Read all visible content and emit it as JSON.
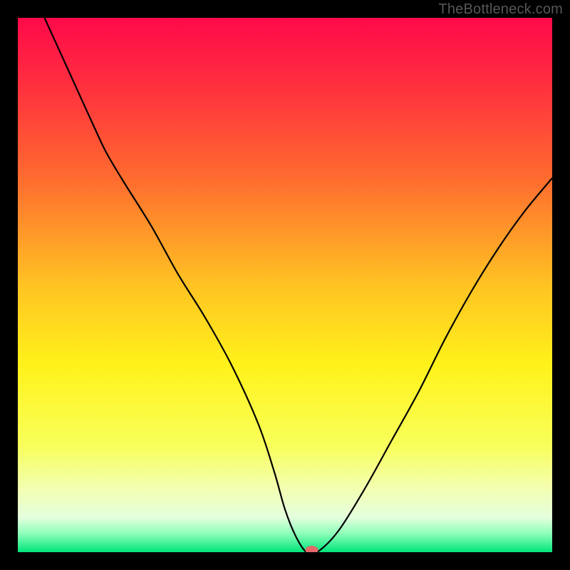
{
  "watermark": "TheBottleneck.com",
  "chart_data": {
    "type": "line",
    "title": "",
    "xlabel": "",
    "ylabel": "",
    "xlim": [
      0,
      100
    ],
    "ylim": [
      0,
      100
    ],
    "background": {
      "kind": "vertical-gradient",
      "stops": [
        {
          "offset": 0.0,
          "color": "#ff0a4a"
        },
        {
          "offset": 0.12,
          "color": "#ff2d3f"
        },
        {
          "offset": 0.3,
          "color": "#ff6b2f"
        },
        {
          "offset": 0.5,
          "color": "#ffc323"
        },
        {
          "offset": 0.65,
          "color": "#fff21a"
        },
        {
          "offset": 0.8,
          "color": "#f8ff5a"
        },
        {
          "offset": 0.88,
          "color": "#f3ffb0"
        },
        {
          "offset": 0.935,
          "color": "#e5ffde"
        },
        {
          "offset": 0.965,
          "color": "#8dffba"
        },
        {
          "offset": 1.0,
          "color": "#00e57a"
        }
      ]
    },
    "series": [
      {
        "name": "bottleneck-curve",
        "color": "#000000",
        "stroke_width": 2.2,
        "x": [
          5,
          10,
          15,
          17,
          20,
          25,
          30,
          35,
          40,
          45,
          48,
          50,
          52,
          54,
          56,
          60,
          65,
          70,
          75,
          80,
          85,
          90,
          95,
          100
        ],
        "y": [
          100,
          89,
          78,
          74,
          69,
          61,
          52,
          44,
          35,
          24,
          15,
          8,
          3,
          0,
          0,
          4,
          12,
          21,
          30,
          40,
          49,
          57,
          64,
          70
        ]
      }
    ],
    "marker": {
      "name": "optimal-point",
      "x": 55,
      "y": 0,
      "color": "#e46a6a",
      "rx": 9,
      "ry": 6
    }
  }
}
